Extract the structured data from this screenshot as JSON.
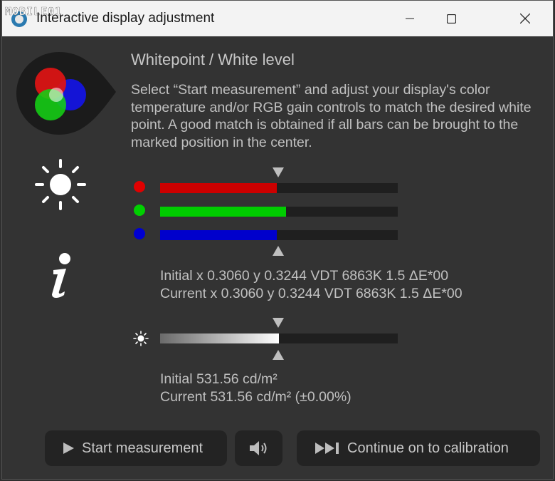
{
  "window": {
    "title": "Interactive display adjustment",
    "watermark": "MOBILE01"
  },
  "titlebar_buttons": {
    "minimize": "—",
    "maximize": "☐",
    "close": "✕"
  },
  "main": {
    "heading": "Whitepoint / White level",
    "description": "Select “Start measurement” and adjust your display's color temperature and/or RGB gain controls to match the desired white point. A good match is obtained if all bars can be brought to the marked position in the center."
  },
  "rgb_bars": {
    "red": {
      "color": "#cc0000",
      "level": 0.49
    },
    "green": {
      "color": "#00cc00",
      "level": 0.53
    },
    "blue": {
      "color": "#0000cc",
      "level": 0.49
    },
    "target": 0.5
  },
  "whitepoint_readout": {
    "initial": "Initial x 0.3060 y 0.3244 VDT 6863K 1.5 ΔE*00",
    "current": "Current x 0.3060 y 0.3244 VDT 6863K 1.5 ΔE*00"
  },
  "luminance_bar": {
    "level": 0.5,
    "target": 0.5
  },
  "luminance_readout": {
    "initial": "Initial 531.56 cd/m²",
    "current": "Current 531.56 cd/m² (±0.00%)"
  },
  "buttons": {
    "start": "Start measurement",
    "continue": "Continue on to calibration"
  },
  "icons": {
    "start": "play-icon",
    "sound": "speaker-icon",
    "continue": "skip-forward-icon"
  }
}
